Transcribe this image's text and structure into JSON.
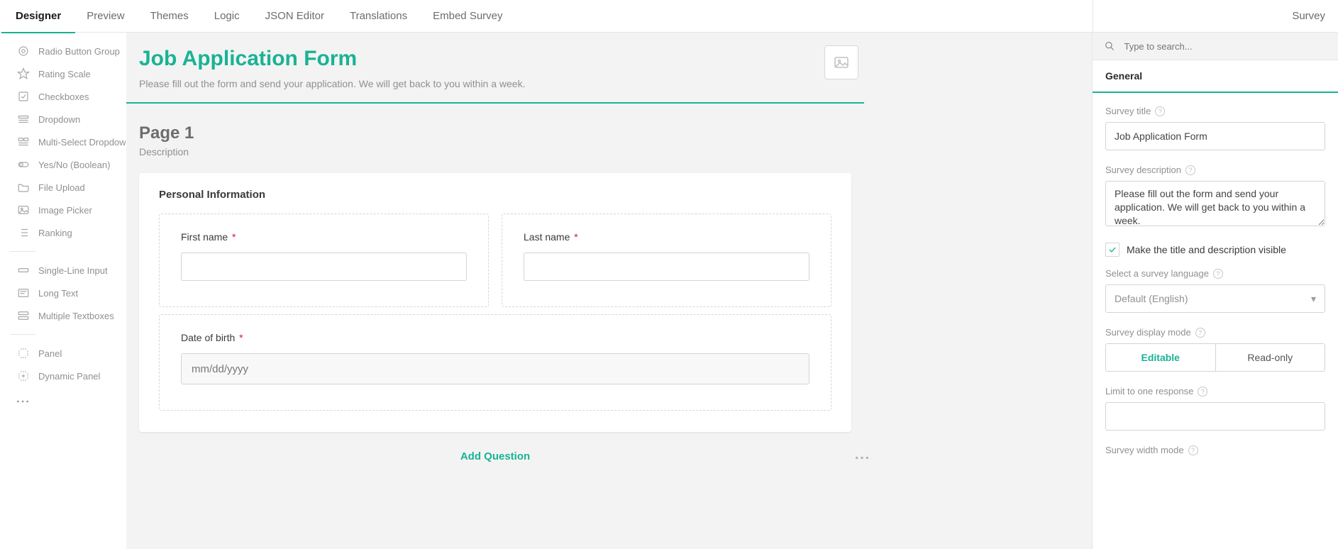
{
  "tabs": {
    "designer": "Designer",
    "preview": "Preview",
    "themes": "Themes",
    "logic": "Logic",
    "json": "JSON Editor",
    "translations": "Translations",
    "embed": "Embed Survey"
  },
  "toolbox": {
    "items": [
      "Radio Button Group",
      "Rating Scale",
      "Checkboxes",
      "Dropdown",
      "Multi-Select Dropdown",
      "Yes/No (Boolean)",
      "File Upload",
      "Image Picker",
      "Ranking"
    ],
    "group2": [
      "Single-Line Input",
      "Long Text",
      "Multiple Textboxes"
    ],
    "group3": [
      "Panel",
      "Dynamic Panel"
    ]
  },
  "survey": {
    "title": "Job Application Form",
    "description": "Please fill out the form and send your application. We will get back to you within a week."
  },
  "page": {
    "title": "Page 1",
    "description": "Description"
  },
  "panel": {
    "title": "Personal Information",
    "first_name": "First name",
    "last_name": "Last name",
    "dob": "Date of birth",
    "dob_placeholder": "mm/dd/yyyy"
  },
  "actions": {
    "add_question": "Add Question"
  },
  "props": {
    "header": "Survey",
    "search_placeholder": "Type to search...",
    "tab_general": "General",
    "survey_title_label": "Survey title",
    "survey_title_value": "Job Application Form",
    "survey_desc_label": "Survey description",
    "survey_desc_value": "Please fill out the form and send your application. We will get back to you within a week.",
    "visible_chk": "Make the title and description visible",
    "lang_label": "Select a survey language",
    "lang_value": "Default (English)",
    "display_mode_label": "Survey display mode",
    "display_mode_editable": "Editable",
    "display_mode_readonly": "Read-only",
    "limit_label": "Limit to one response",
    "width_mode_label": "Survey width mode"
  }
}
